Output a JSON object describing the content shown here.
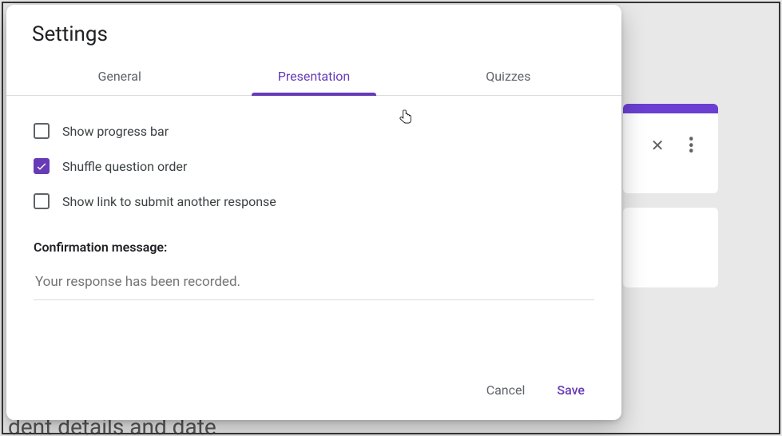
{
  "modal": {
    "title": "Settings",
    "tabs": {
      "general": "General",
      "presentation": "Presentation",
      "quizzes": "Quizzes",
      "active": "presentation"
    },
    "options": {
      "progress": {
        "label": "Show progress bar",
        "checked": false
      },
      "shuffle": {
        "label": "Shuffle question order",
        "checked": true
      },
      "another": {
        "label": "Show link to submit another response",
        "checked": false
      }
    },
    "confirmation": {
      "label": "Confirmation message:",
      "placeholder": "Your response has been recorded.",
      "value": ""
    },
    "actions": {
      "cancel": "Cancel",
      "save": "Save"
    }
  },
  "background": {
    "partial_text": "dent details and date"
  },
  "colors": {
    "accent": "#673ab7"
  }
}
